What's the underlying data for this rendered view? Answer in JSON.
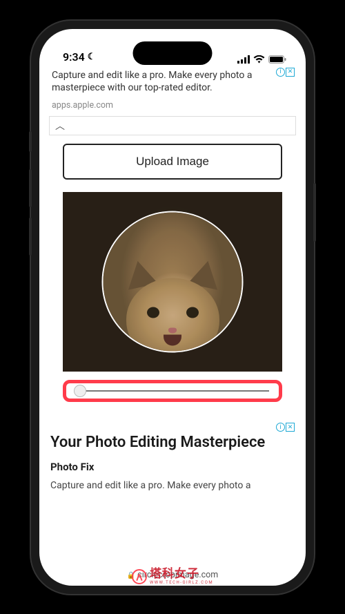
{
  "status": {
    "time": "9:34",
    "dnd_icon": "moon"
  },
  "ad_top": {
    "description": "Capture and edit like a pro. Make every photo a masterpiece with our top-rated editor.",
    "domain": "apps.apple.com",
    "info_label": "i",
    "close_label": "✕"
  },
  "cropper": {
    "upload_button": "Upload Image",
    "slider_value": 2
  },
  "ad_bottom": {
    "title": "Your Photo Editing Masterpiece",
    "brand": "Photo Fix",
    "description": "Capture and edit like a pro. Make every photo a",
    "info_label": "i",
    "close_label": "✕"
  },
  "browser": {
    "url": "circlecropimage.com"
  },
  "watermark": {
    "main": "塔科女子",
    "sub": "WWW.TECH-GIRLZ.COM"
  }
}
